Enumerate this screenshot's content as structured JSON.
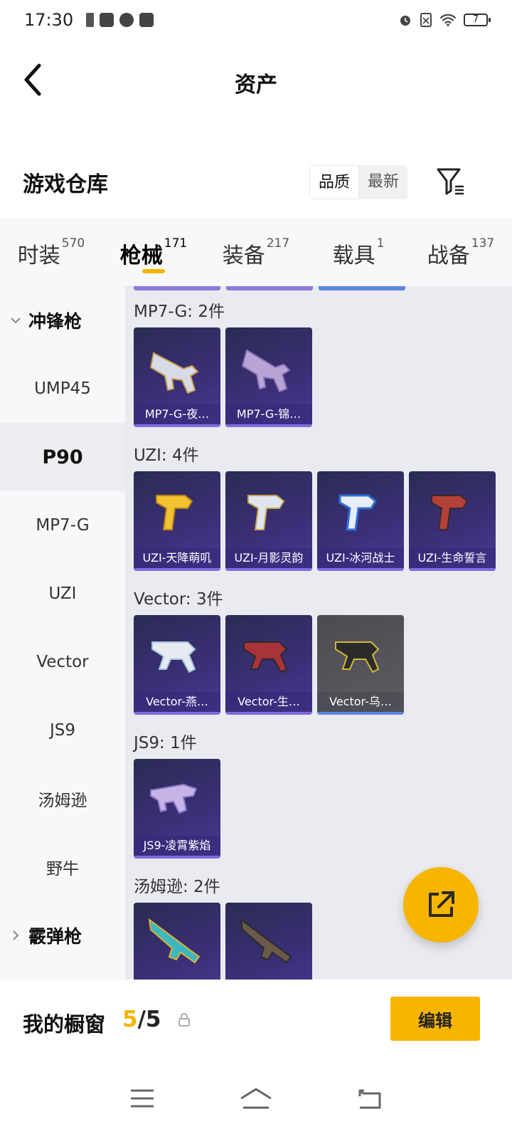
{
  "status_bar": {
    "time": "17:30",
    "battery": "7"
  },
  "header": {
    "title": "资产"
  },
  "warehouse": {
    "title": "游戏仓库",
    "sort_options": [
      "品质",
      "最新"
    ],
    "active_sort": "品质"
  },
  "tabs": [
    {
      "label": "时装",
      "count": "570"
    },
    {
      "label": "枪械",
      "count": "171",
      "active": true
    },
    {
      "label": "装备",
      "count": "217"
    },
    {
      "label": "载具",
      "count": "1"
    },
    {
      "label": "战备",
      "count": "137"
    }
  ],
  "sidebar": {
    "group_smg": "冲锋枪",
    "items": [
      "UMP45",
      "P90",
      "MP7-G",
      "UZI",
      "Vector",
      "JS9",
      "汤姆逊",
      "野牛"
    ],
    "active_item": "P90",
    "group_shotgun": "霰弹枪"
  },
  "groups": [
    {
      "title": "MP7-G: 2件",
      "items": [
        "MP7-G-夜…",
        "MP7-G-锦…"
      ]
    },
    {
      "title": "UZI: 4件",
      "items": [
        "UZI-天降萌叽",
        "UZI-月影灵韵",
        "UZI-冰河战士",
        "UZI-生命誓言"
      ]
    },
    {
      "title": "Vector: 3件",
      "items": [
        "Vector-燕…",
        "Vector-生…",
        "Vector-乌…"
      ]
    },
    {
      "title": "JS9: 1件",
      "items": [
        "JS9-凌霄紫焰"
      ]
    },
    {
      "title": "汤姆逊: 2件",
      "items": [
        "",
        ""
      ]
    }
  ],
  "showcase": {
    "label": "我的橱窗",
    "current": "5",
    "separator": "/",
    "total": "5",
    "edit_label": "编辑"
  },
  "colors": {
    "accent": "#f5b400",
    "card_purple": "#3c2f78",
    "rarity_blue": "#5a86e0"
  }
}
